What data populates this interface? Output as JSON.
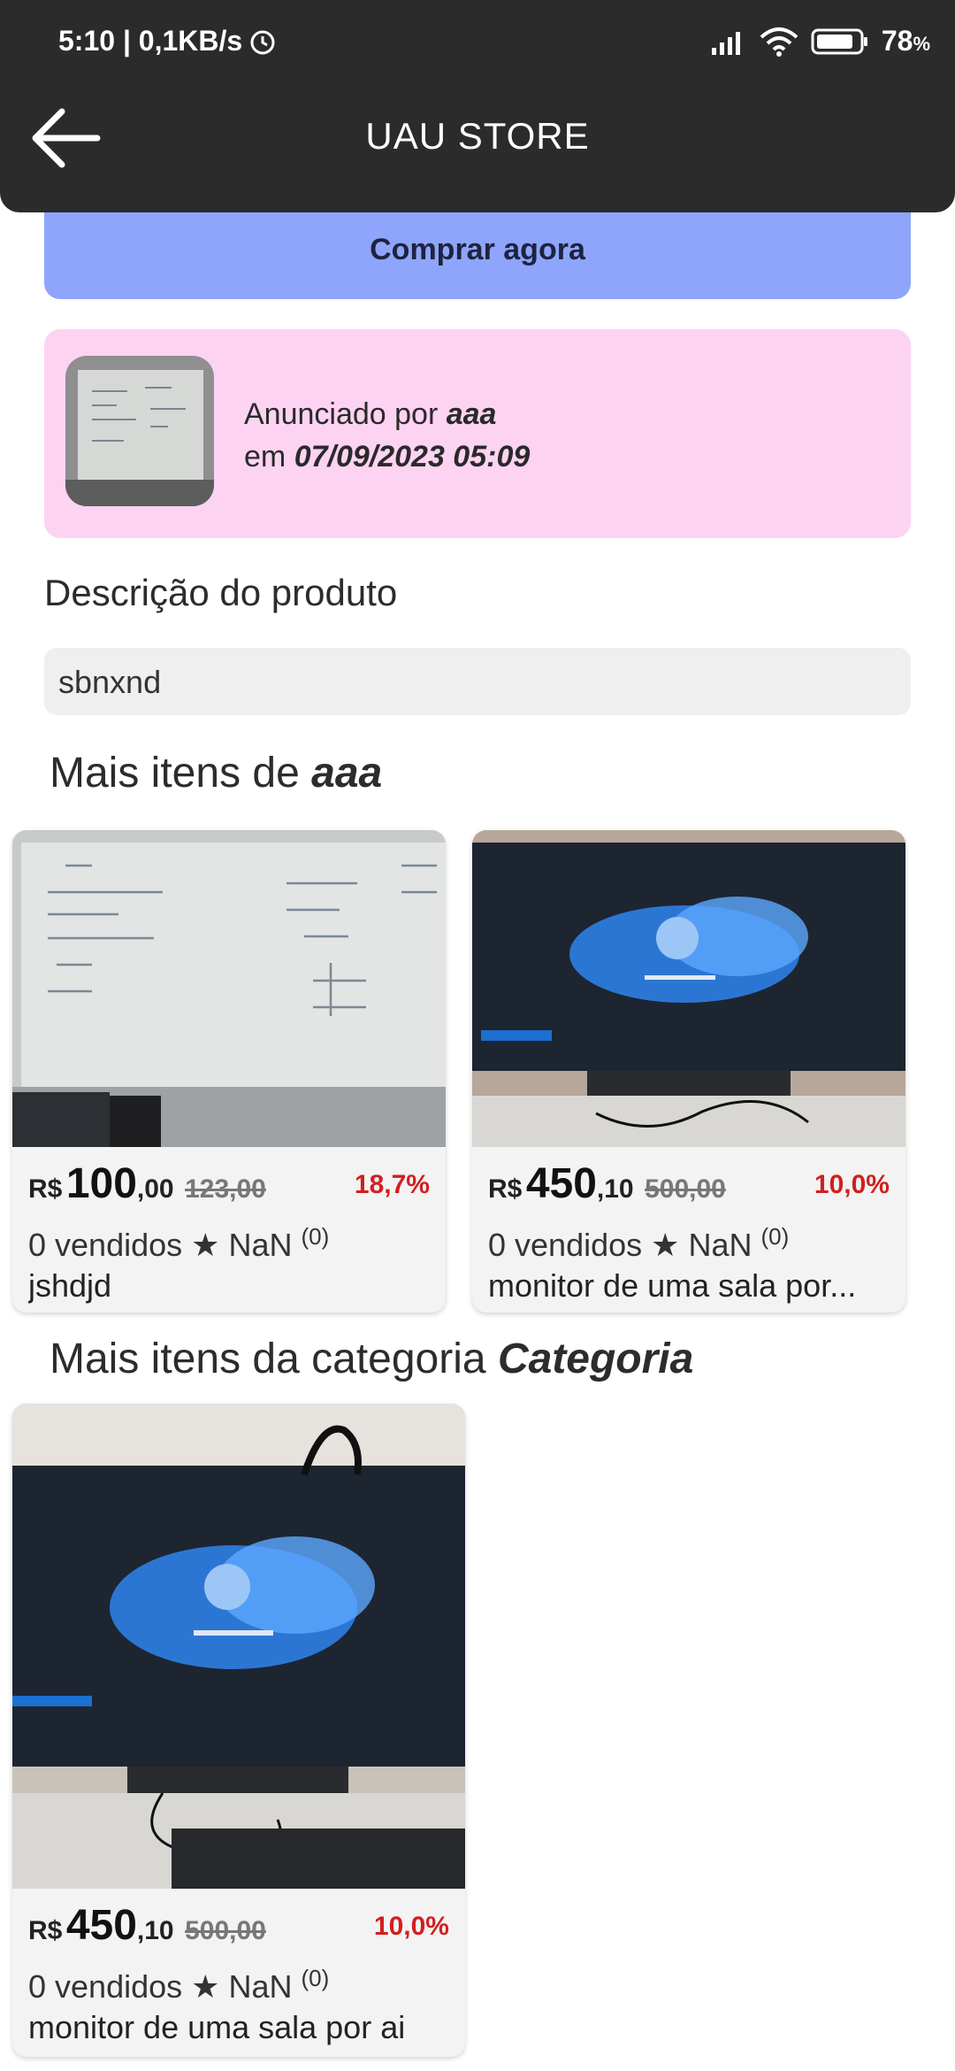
{
  "status_bar": {
    "time": "5:10 | 0,1KB/s",
    "battery": "78",
    "battery_unit": "%",
    "icons": [
      "alarm-icon",
      "signal-icon",
      "wifi-icon",
      "battery-icon"
    ]
  },
  "app_bar": {
    "title": "UAU STORE",
    "back_icon": "arrow-left-icon"
  },
  "buy_button": {
    "label": "Comprar agora"
  },
  "seller": {
    "prefix": "Anunciado por",
    "name": "aaa",
    "date_prefix": "em",
    "date": "07/09/2023 05:09"
  },
  "description": {
    "title": "Descrição do produto",
    "text": "sbnxnd"
  },
  "more_from_seller": {
    "title_prefix": "Mais itens de",
    "title_name": "aaa",
    "items": [
      {
        "currency": "R$",
        "price_int": "100",
        "price_cents": ",00",
        "old_price": "123,00",
        "discount": "18,7%",
        "sold": "0 vendidos",
        "rating": "NaN",
        "reviews": "(0)",
        "name": "jshdjd"
      },
      {
        "currency": "R$",
        "price_int": "450",
        "price_cents": ",10",
        "old_price": "500,00",
        "discount": "10,0%",
        "sold": "0 vendidos",
        "rating": "NaN",
        "reviews": "(0)",
        "name": "monitor de uma sala por..."
      }
    ]
  },
  "more_from_category": {
    "title_prefix": "Mais itens da categoria",
    "title_name": "Categoria",
    "items": [
      {
        "currency": "R$",
        "price_int": "450",
        "price_cents": ",10",
        "old_price": "500,00",
        "discount": "10,0%",
        "sold": "0 vendidos",
        "rating": "NaN",
        "reviews": "(0)",
        "name": "monitor de uma sala por ai"
      }
    ]
  },
  "colors": {
    "app_bar": "#2b2b2b",
    "buy_button": "#8fa5fb",
    "seller_card": "#fdd3f2",
    "discount": "#d21f1f"
  }
}
